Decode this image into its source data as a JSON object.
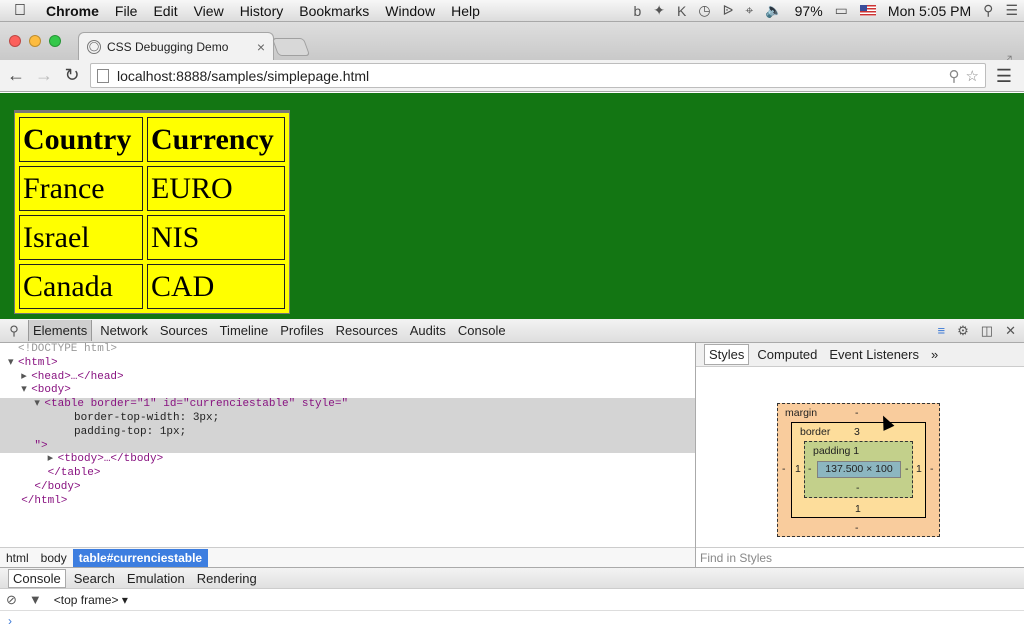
{
  "menubar": {
    "app": "Chrome",
    "items": [
      "File",
      "Edit",
      "View",
      "History",
      "Bookmarks",
      "Window",
      "Help"
    ],
    "battery": "97%",
    "clock": "Mon 5:05 PM"
  },
  "tab": {
    "title": "CSS Debugging Demo",
    "close": "×"
  },
  "toolbar": {
    "url_host": "localhost",
    "url_path": ":8888/samples/simplepage.html"
  },
  "page": {
    "table": {
      "headers": [
        "Country",
        "Currency"
      ],
      "rows": [
        [
          "France",
          "EURO"
        ],
        [
          "Israel",
          "NIS"
        ],
        [
          "Canada",
          "CAD"
        ]
      ]
    }
  },
  "devtools": {
    "tabs": [
      "Elements",
      "Network",
      "Sources",
      "Timeline",
      "Profiles",
      "Resources",
      "Audits",
      "Console"
    ],
    "dom": {
      "doctype": "<!DOCTYPE html>",
      "html_open": "<html>",
      "head": "<head>…</head>",
      "body_open": "<body>",
      "table_open": "<table border=\"1\" id=\"currenciestable\" style=\"",
      "css_line1": "border-top-width: 3px;",
      "css_line2": "padding-top: 1px;",
      "quote_close": "\">",
      "tbody": "<tbody>…</tbody>",
      "table_close": "</table>",
      "body_close": "</body>",
      "html_close": "</html>"
    },
    "breadcrumbs": [
      "html",
      "body",
      "table#currenciestable"
    ],
    "styles_tabs": [
      "Styles",
      "Computed",
      "Event Listeners",
      "»"
    ],
    "box_model": {
      "margin_label": "margin",
      "margin_top": "-",
      "margin_bottom": "-",
      "margin_left": "-",
      "margin_right": "-",
      "border_label": "border",
      "border_top": "3",
      "border_bottom": "1",
      "border_left": "1",
      "border_right": "1",
      "padding_label": "padding 1",
      "padding_bottom": "-",
      "padding_left": "-",
      "padding_right": "-",
      "content": "137.500 × 100"
    },
    "find_styles_placeholder": "Find in Styles",
    "drawer_tabs": [
      "Console",
      "Search",
      "Emulation",
      "Rendering"
    ],
    "frame_select": "<top frame>",
    "prompt": "›"
  },
  "colors": {
    "page_bg": "#137613",
    "table_bg": "#ffff00",
    "selected_crumb": "#3d7ee0"
  }
}
